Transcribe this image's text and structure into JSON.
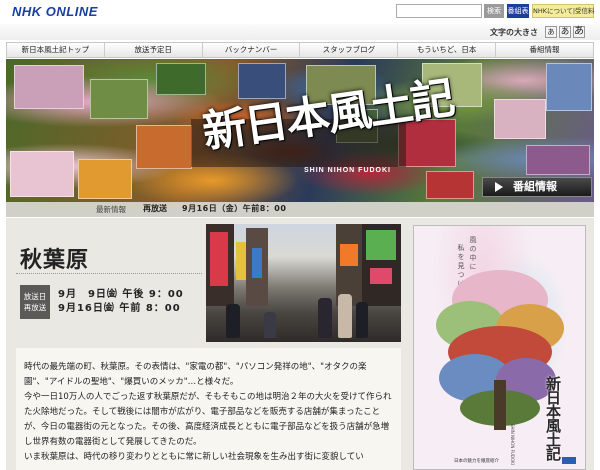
{
  "header": {
    "logo": "NHK ONLINE",
    "search_placeholder": "",
    "search_button": "検索",
    "keyword_button": "番組表",
    "about_button": "NHKについて|受信料"
  },
  "font_size": {
    "label": "文字の大きさ",
    "options": [
      "あ",
      "あ",
      "あ"
    ]
  },
  "nav": {
    "items": [
      "新日本風土記トップ",
      "放送予定日",
      "バックナンバー",
      "スタッフブログ",
      "もういちど、日本",
      "番組情報"
    ]
  },
  "banner": {
    "title": "新日本風土記",
    "romaji": "SHIN NIHON FUDOKI",
    "program_info_button": "番組情報"
  },
  "latest": {
    "label": "最新情報",
    "text": "再放送",
    "date": "9月16日（金）午前8：00"
  },
  "episode": {
    "title": "秋葉原",
    "air_label_1": "放送日",
    "air_label_2": "再放送",
    "air_date_1": "9月　9日㈮ 午後 9：00",
    "air_date_2": "9月16日㈮ 午前 8：00"
  },
  "body": {
    "paragraphs": [
      "時代の最先端の町、秋葉原。その表情は、\"家電の都\"、\"パソコン発祥の地\"、\"オタクの楽園\"、\"アイドルの聖地\"、\"爆買いのメッカ\"…と様々だ。",
      "今や一日10万人の人でごった返す秋葉原だが、そもそもこの地は明治２年の大火を受けて作られた火除地だった。そして戦後には闇市が広がり、電子部品などを販売する店舗が集まったことが、今日の電器街の元となった。その後、高度経済成長とともに電子部品などを扱う店舗が急増し世界有数の電器街として発展してきたのだ。",
      "いま秋葉原は、時代の移り変わりとともに常に新しい社会現象を生み出す街に変貌してい"
    ]
  },
  "poster": {
    "vertical_text_1": "風の中に",
    "vertical_text_2": "私を見つける。",
    "title": "新日本風土記",
    "romaji": "SHIN NIHON FUDOKI",
    "footer": "日本の魅力を徹底紹介"
  }
}
